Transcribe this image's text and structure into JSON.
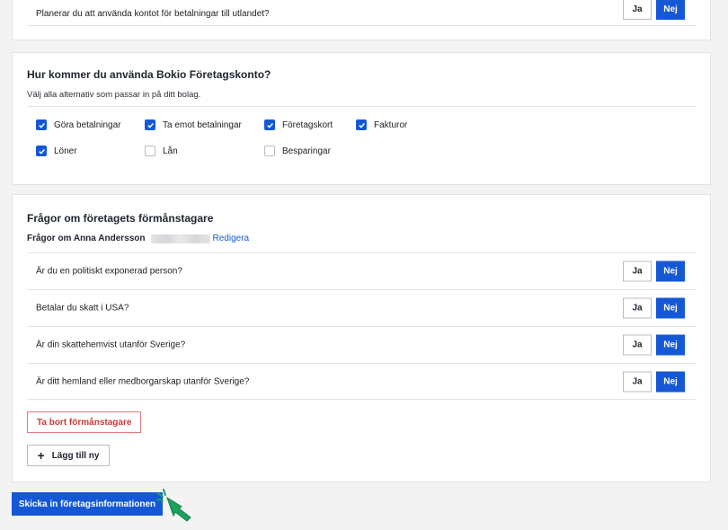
{
  "top_question": {
    "text": "Planerar du att använda kontot för betalningar till utlandet?",
    "yes": "Ja",
    "no": "Nej"
  },
  "usage": {
    "title": "Hur kommer du använda Bokio Företagskonto?",
    "subtitle": "Välj alla alternativ som passar in på ditt bolag.",
    "options": [
      {
        "label": "Göra betalningar",
        "checked": true
      },
      {
        "label": "Ta emot betalningar",
        "checked": true
      },
      {
        "label": "Företagskort",
        "checked": true
      },
      {
        "label": "Fakturor",
        "checked": true
      },
      {
        "label": "Löner",
        "checked": true
      },
      {
        "label": "Lån",
        "checked": false
      },
      {
        "label": "Besparingar",
        "checked": false
      }
    ]
  },
  "beneficial": {
    "title": "Frågor om företagets förmånstagare",
    "owner_prefix": "Frågor om Anna Andersson",
    "edit_label": "Redigera",
    "questions": [
      {
        "text": "Är du en politiskt exponerad person?",
        "yes": "Ja",
        "no": "Nej"
      },
      {
        "text": "Betalar du skatt i USA?",
        "yes": "Ja",
        "no": "Nej"
      },
      {
        "text": "Är din skattehemvist utanför Sverige?",
        "yes": "Ja",
        "no": "Nej"
      },
      {
        "text": "Är ditt hemland eller medborgarskap utanför Sverige?",
        "yes": "Ja",
        "no": "Nej"
      }
    ],
    "remove_label": "Ta bort förmånstagare",
    "add_label": "Lägg till ny"
  },
  "submit_label": "Skicka in företagsinformationen",
  "colors": {
    "primary": "#1558d6",
    "danger": "#c93a3a",
    "cursor": "#1aa35a"
  },
  "icons": {
    "checkbox_checked": "check-icon",
    "add": "plus-icon",
    "cursor": "hand-pointer-icon"
  }
}
